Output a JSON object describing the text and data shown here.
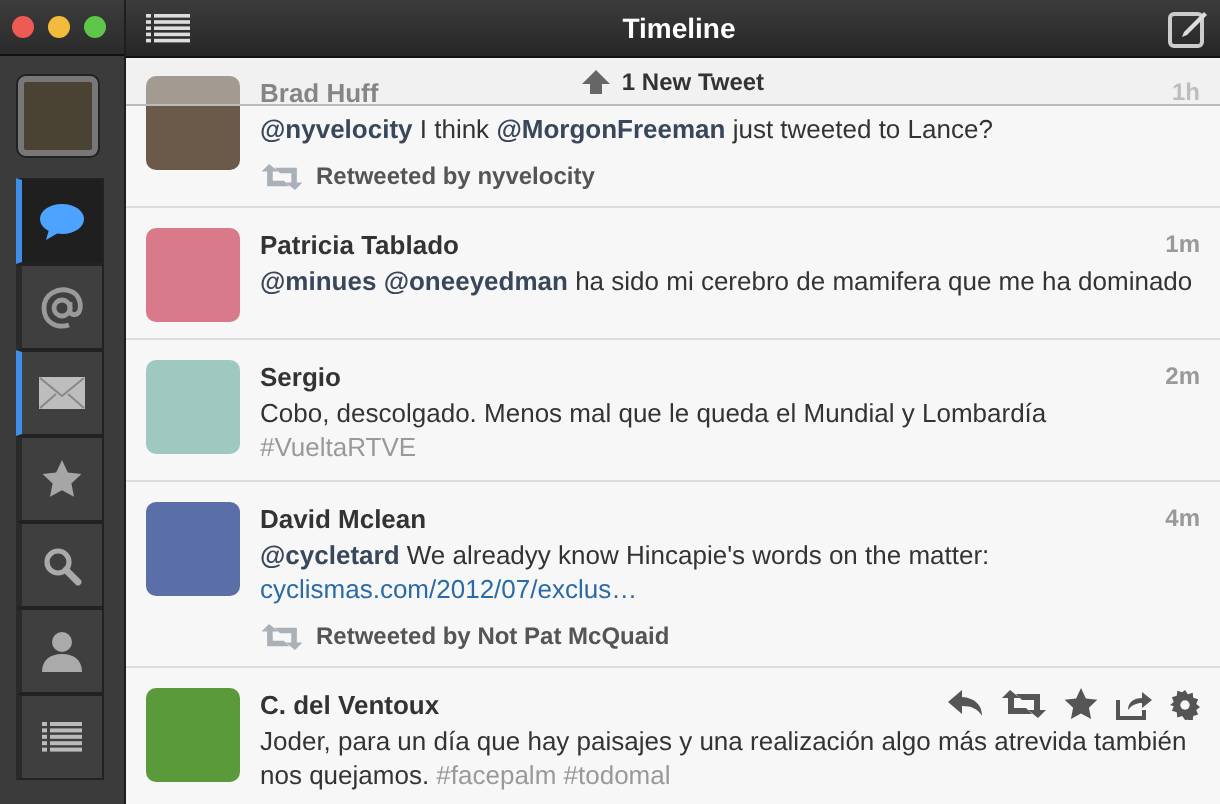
{
  "window": {
    "title": "Timeline"
  },
  "sidebar": {
    "items": [
      {
        "kind": "timeline",
        "selected": true,
        "unread": true
      },
      {
        "kind": "mentions",
        "selected": false,
        "unread": false
      },
      {
        "kind": "messages",
        "selected": false,
        "unread": true
      },
      {
        "kind": "favorites",
        "selected": false,
        "unread": false
      },
      {
        "kind": "search",
        "selected": false,
        "unread": false
      },
      {
        "kind": "profile",
        "selected": false,
        "unread": false
      },
      {
        "kind": "lists",
        "selected": false,
        "unread": false
      }
    ]
  },
  "new_tweets_bar": {
    "label": "1 New Tweet"
  },
  "tweets": [
    {
      "name": "Brad Huff",
      "time": "1h",
      "body": [
        {
          "kind": "mention",
          "text": "@nyvelocity"
        },
        {
          "kind": "text",
          "text": " I think "
        },
        {
          "kind": "mention",
          "text": "@MorgonFreeman"
        },
        {
          "kind": "text",
          "text": " just tweeted to Lance?"
        }
      ],
      "retweeted_by": "Retweeted by nyvelocity"
    },
    {
      "name": "Patricia Tablado",
      "time": "1m",
      "body": [
        {
          "kind": "mention",
          "text": "@minues "
        },
        {
          "kind": "mention",
          "text": "@oneeyedman"
        },
        {
          "kind": "text",
          "text": " ha sido mi cerebro de mamifera que me ha dominado"
        }
      ]
    },
    {
      "name": "Sergio",
      "time": "2m",
      "body": [
        {
          "kind": "text",
          "text": "Cobo, descolgado. Menos mal que le queda el Mundial y Lombardía "
        },
        {
          "kind": "hashtag",
          "text": "#VueltaRTVE"
        }
      ]
    },
    {
      "name": "David Mclean",
      "time": "4m",
      "body": [
        {
          "kind": "mention",
          "text": "@cycletard"
        },
        {
          "kind": "text",
          "text": " We alreadyy know Hincapie's words on the matter: "
        },
        {
          "kind": "link",
          "text": "cyclismas.com/"
        },
        {
          "kind": "link",
          "text": "2012/07/exclus…"
        }
      ],
      "retweeted_by": "Retweeted by Not Pat McQuaid"
    },
    {
      "name": "C. del Ventoux",
      "body": [
        {
          "kind": "text",
          "text": "Joder, para un día que hay paisajes y una realización algo más atrevida también nos quejamos. "
        },
        {
          "kind": "hashtag",
          "text": "#facepalm #todomal"
        }
      ],
      "actions": [
        {
          "kind": "reply"
        },
        {
          "kind": "retweet"
        },
        {
          "kind": "favorite"
        },
        {
          "kind": "share"
        },
        {
          "kind": "settings"
        }
      ]
    }
  ]
}
